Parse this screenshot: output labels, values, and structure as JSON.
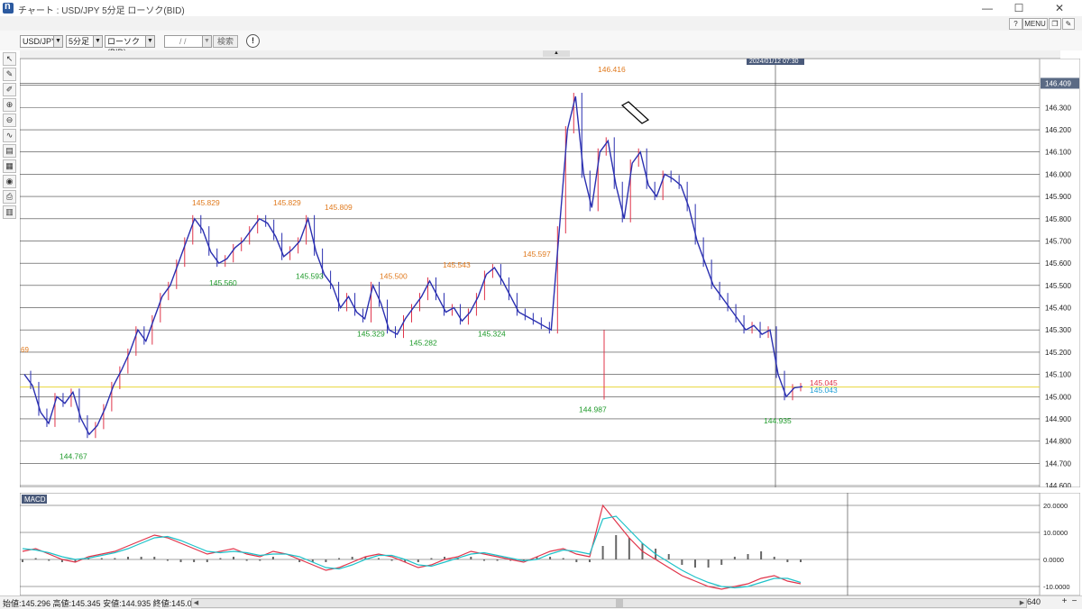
{
  "window": {
    "title": "チャート : USD/JPY 5分足 ローソク(BID)",
    "min_icon": "minimize-icon",
    "max_icon": "maximize-icon",
    "close_icon": "close-icon"
  },
  "menu": {
    "help_label": "?",
    "menu_label": "MENU ▼"
  },
  "toolbar": {
    "pair": "USD/JPY",
    "timeframe": "5分足",
    "chart_type": "ローソク(BID)",
    "date_value": "/ /",
    "search_label": "検索"
  },
  "crosshair_label": "2024/01/12 07:30",
  "chart_data": [
    {
      "type": "candlestick",
      "title": "USD/JPY 5分足 ローソク(BID)",
      "ylim": [
        144.6,
        146.5
      ],
      "y_ticks": [
        "146.400",
        "146.300",
        "146.200",
        "146.100",
        "146.000",
        "145.900",
        "145.800",
        "145.700",
        "145.600",
        "145.500",
        "145.400",
        "145.300",
        "145.200",
        "145.100",
        "145.000",
        "144.900",
        "144.800",
        "144.700",
        "144.600"
      ],
      "current_price_label": "146.409",
      "price_labels": [
        {
          "text": "145.045",
          "color": "#e0344a"
        },
        {
          "text": "145.043",
          "color": "#1e9fd6"
        }
      ],
      "left_edge_label": "69",
      "high_annotations": [
        "145.829",
        "145.829",
        "145.809",
        "145.500",
        "145.543",
        "145.597",
        "146.416"
      ],
      "low_annotations": [
        "144.767",
        "145.560",
        "145.593",
        "145.329",
        "145.282",
        "145.324",
        "144.987",
        "144.935"
      ],
      "close_path": [
        145.1,
        145.05,
        144.93,
        144.88,
        145.0,
        144.97,
        145.02,
        144.9,
        144.83,
        144.87,
        144.95,
        145.05,
        145.12,
        145.2,
        145.3,
        145.25,
        145.35,
        145.45,
        145.5,
        145.6,
        145.7,
        145.8,
        145.75,
        145.65,
        145.6,
        145.62,
        145.67,
        145.7,
        145.75,
        145.8,
        145.78,
        145.72,
        145.63,
        145.66,
        145.7,
        145.8,
        145.65,
        145.55,
        145.5,
        145.4,
        145.45,
        145.38,
        145.35,
        145.5,
        145.42,
        145.3,
        145.28,
        145.35,
        145.4,
        145.45,
        145.52,
        145.45,
        145.38,
        145.4,
        145.34,
        145.38,
        145.45,
        145.55,
        145.58,
        145.52,
        145.45,
        145.38,
        145.36,
        145.34,
        145.32,
        145.3,
        145.75,
        146.2,
        146.35,
        146.0,
        145.85,
        146.1,
        146.15,
        145.95,
        145.8,
        146.05,
        146.1,
        145.95,
        145.9,
        146.0,
        145.98,
        145.95,
        145.85,
        145.7,
        145.6,
        145.5,
        145.45,
        145.4,
        145.35,
        145.3,
        145.32,
        145.28,
        145.3,
        145.1,
        145.0,
        145.04,
        145.045
      ],
      "close_color": "#2a2fb0",
      "up_color": "#e0344a"
    },
    {
      "type": "line",
      "title": "MACD",
      "y_ticks": [
        "20.0000",
        "10.0000",
        "0.0000",
        "-10.0000"
      ],
      "ylim": [
        -12,
        22
      ],
      "series": [
        {
          "name": "MACD",
          "color": "#e0344a",
          "values": [
            3,
            4,
            2,
            0,
            -1,
            1,
            2,
            3,
            5,
            7,
            9,
            8,
            6,
            4,
            2,
            3,
            4,
            2,
            1,
            3,
            2,
            0,
            -2,
            -4,
            -3,
            -1,
            1,
            2,
            1,
            -1,
            -3,
            -2,
            0,
            1,
            3,
            2,
            1,
            0,
            -1,
            1,
            3,
            4,
            2,
            1,
            20,
            14,
            8,
            3,
            0,
            -3,
            -6,
            -8,
            -10,
            -11,
            -10,
            -9,
            -7,
            -6,
            -8,
            -9
          ]
        },
        {
          "name": "Signal",
          "color": "#1ec2c9",
          "values": [
            4,
            3.5,
            2.5,
            1,
            0,
            0.5,
            1.5,
            2.5,
            4,
            6,
            8,
            8.5,
            7,
            5,
            3,
            2.5,
            3,
            2.5,
            1.5,
            2,
            2,
            1,
            -1,
            -3,
            -3.5,
            -2,
            0,
            1.5,
            1.5,
            0,
            -2,
            -2.5,
            -1,
            0.5,
            2,
            2.5,
            1.5,
            0.5,
            -0.5,
            0,
            2,
            3.5,
            3,
            2,
            15,
            16,
            11,
            6,
            2,
            -1,
            -4,
            -6.5,
            -8.5,
            -10,
            -10.5,
            -10,
            -8.5,
            -7,
            -7,
            -8.5
          ]
        }
      ],
      "histogram": [
        -1,
        0.5,
        -0.5,
        -1,
        -1,
        0.5,
        0.5,
        0.5,
        1,
        1,
        1,
        -0.5,
        -1,
        -1,
        -1,
        0.5,
        1,
        -0.5,
        -0.5,
        1,
        0,
        -1,
        -1,
        -1,
        0.5,
        1,
        1,
        0.5,
        -0.5,
        -1,
        -1,
        0.5,
        1,
        0.5,
        1,
        -0.5,
        -0.5,
        -0.5,
        -0.5,
        1,
        1,
        0.5,
        -1,
        -1,
        5,
        9,
        8,
        6,
        4,
        2,
        -2,
        -3,
        -3,
        -2,
        1,
        2,
        3,
        1,
        -1,
        -1
      ]
    }
  ],
  "status": {
    "ohlc_text": "始値:145.296  高値:145.345  安値:144.935  終値:145.043",
    "zoom": "640"
  }
}
